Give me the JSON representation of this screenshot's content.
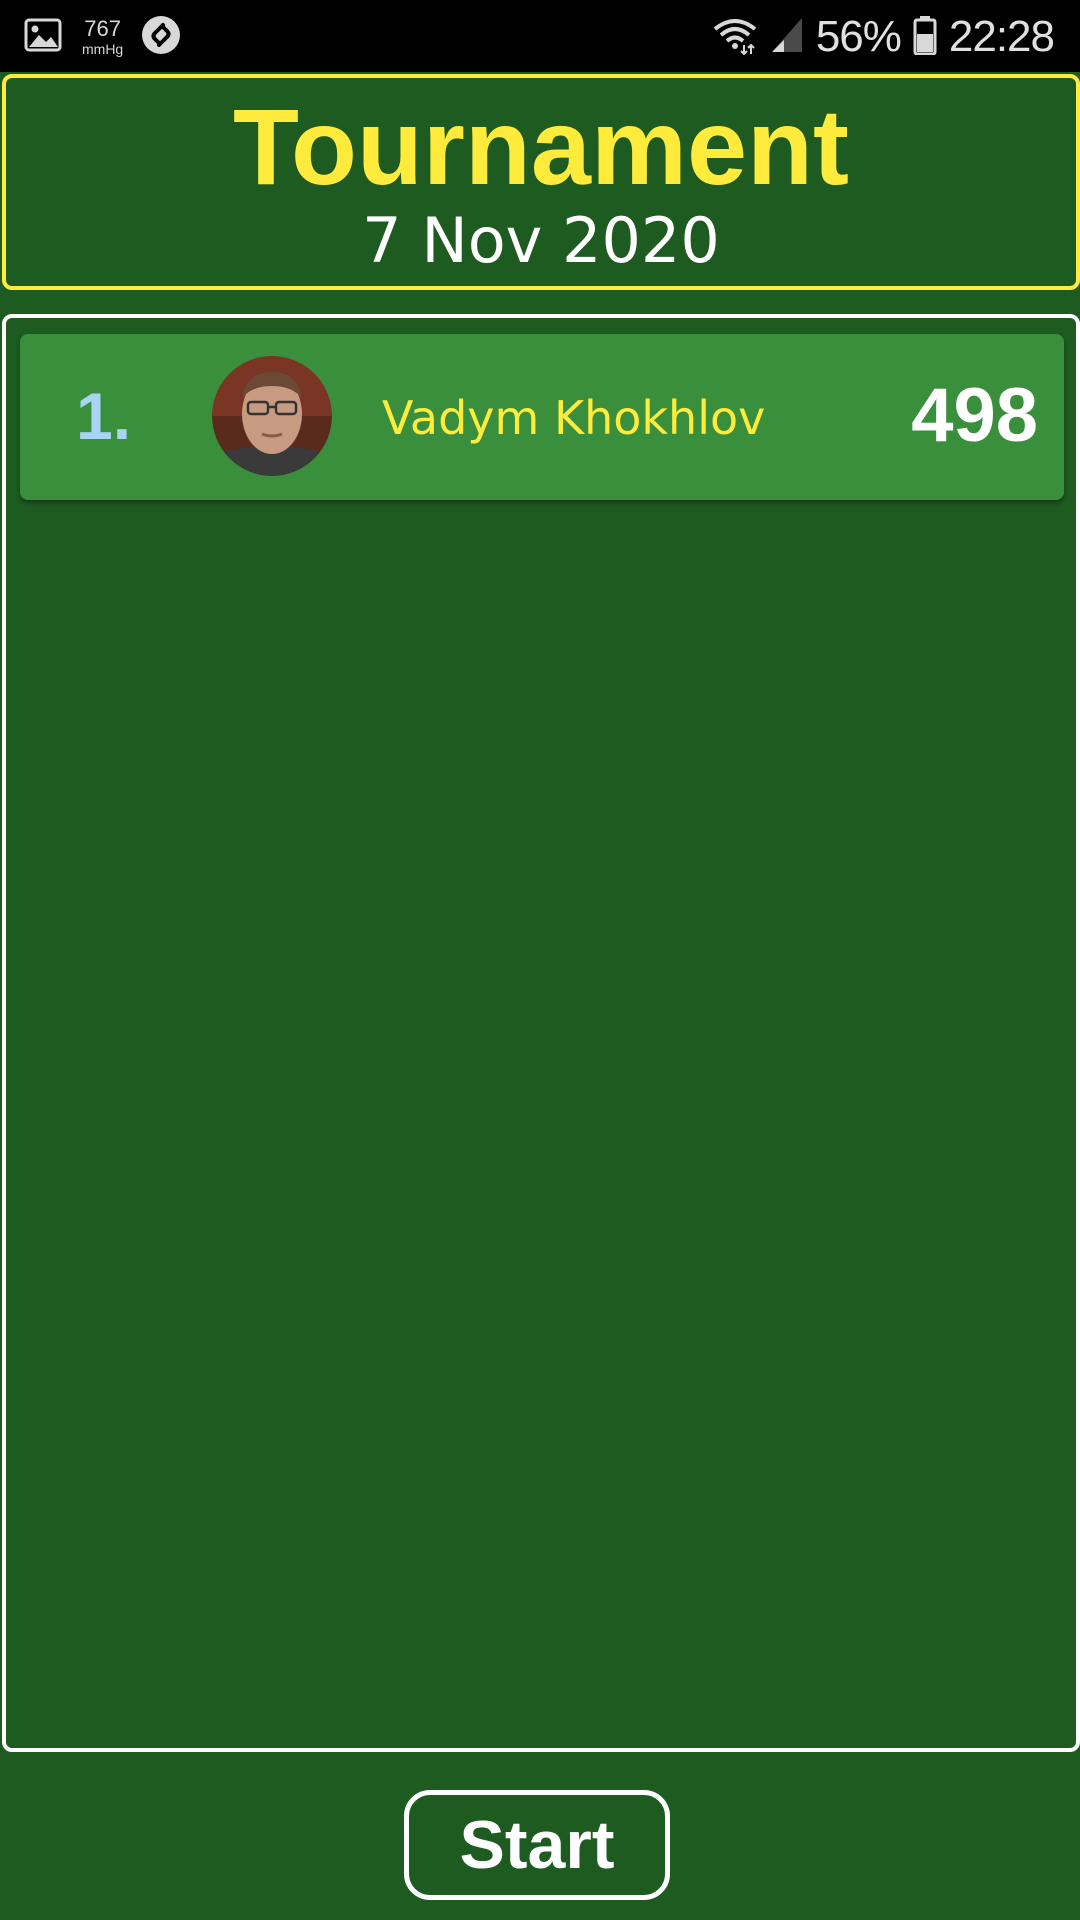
{
  "status_bar": {
    "pressure_value": "767",
    "pressure_unit": "mmHg",
    "battery": "56%",
    "time": "22:28",
    "icons": [
      "gallery-icon",
      "shazam-icon",
      "wifi-icon",
      "signal-icon",
      "battery-icon"
    ]
  },
  "header": {
    "title": "Tournament",
    "date": "7 Nov 2020"
  },
  "leaderboard": {
    "rows": [
      {
        "rank": "1.",
        "name": "Vadym Khokhlov",
        "score": "498"
      }
    ]
  },
  "actions": {
    "start_label": "Start"
  },
  "colors": {
    "background": "#1e5b20",
    "row": "#3a8f3c",
    "accent_yellow": "#ffeb3b",
    "rank_blue": "#a9d4f5"
  }
}
